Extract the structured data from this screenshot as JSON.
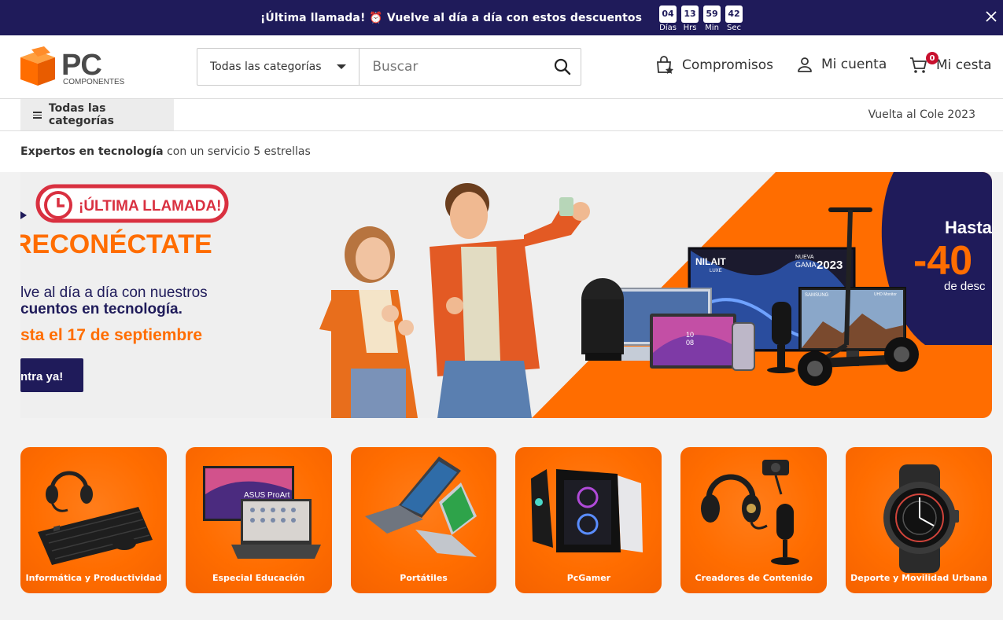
{
  "promo": {
    "text": "¡Última llamada! ⏰ Vuelve al día a día con estos descuentos",
    "countdown": [
      {
        "value": "04",
        "label": "Días"
      },
      {
        "value": "13",
        "label": "Hrs"
      },
      {
        "value": "59",
        "label": "Min"
      },
      {
        "value": "42",
        "label": "Sec"
      }
    ]
  },
  "header": {
    "logo_text": "PC",
    "logo_sub": "COMPONENTES",
    "category_select": "Todas las categorías",
    "search_placeholder": "Buscar",
    "links": {
      "commitments": "Compromisos",
      "account": "Mi cuenta",
      "cart": "Mi cesta",
      "cart_count": "0"
    }
  },
  "nav": {
    "all_categories": "Todas las categorías",
    "promo_link": "Vuelta al Cole 2023"
  },
  "tagline": {
    "bold": "Expertos en tecnología",
    "rest": " con un servicio 5 estrellas"
  },
  "hero": {
    "badge": "¡ÚLTIMA LLAMADA!",
    "headline": "RECONÉCTATE",
    "line1": "lve al día a día con nuestros",
    "line2": "cuentos  en tecnología.",
    "line3": "sta el 17 de septiembre",
    "cta": "ntra ya!",
    "discount_top": "Hasta",
    "discount_value": "-40",
    "discount_bottom": "de desc",
    "tv_brand": "NILAIT",
    "tv_sub": "LUXE",
    "tv_tag1": "NUEVA",
    "tv_tag2": "GAMA",
    "tv_year": "2023",
    "monitor_brand": "SAMSUNG",
    "monitor_tag": "UHD Monitor",
    "monitor_tag_logo": "ASUS ProArt",
    "tablet_time": "10\n08"
  },
  "categories": [
    {
      "label": "Informática y Productividad",
      "icon": "keyboard-headset-icon"
    },
    {
      "label": "Especial Educación",
      "icon": "laptop-monitor-icon"
    },
    {
      "label": "Portátiles",
      "icon": "laptops-icon"
    },
    {
      "label": "PcGamer",
      "icon": "gaming-pc-icon"
    },
    {
      "label": "Creadores de Contenido",
      "icon": "headset-mic-webcam-icon"
    },
    {
      "label": "Deporte y Movilidad Urbana",
      "icon": "smartwatch-icon"
    }
  ],
  "colors": {
    "brand_orange": "#ff6d00",
    "promo_navy": "#1f1b5a",
    "cart_badge": "#c8102e"
  }
}
